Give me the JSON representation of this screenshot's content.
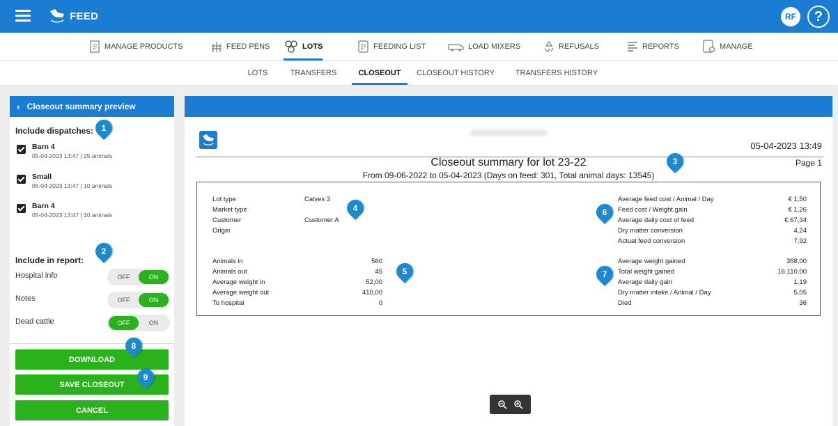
{
  "app": {
    "title": "FEED",
    "user_initials": "RF",
    "help_glyph": "?"
  },
  "main_nav": [
    {
      "label": "MANAGE PRODUCTS",
      "icon": "products-icon"
    },
    {
      "label": "FEED PENS",
      "icon": "pen-icon"
    },
    {
      "label": "LOTS",
      "icon": "lots-icon",
      "active": true
    },
    {
      "label": "FEEDING LIST",
      "icon": "list-icon"
    },
    {
      "label": "LOAD MIXERS",
      "icon": "mixer-icon"
    },
    {
      "label": "REFUSALS",
      "icon": "recycle-icon"
    },
    {
      "label": "REPORTS",
      "icon": "report-icon"
    },
    {
      "label": "MANAGE",
      "icon": "manage-icon"
    }
  ],
  "sub_nav": [
    {
      "label": "LOTS"
    },
    {
      "label": "TRANSFERS"
    },
    {
      "label": "CLOSEOUT",
      "active": true
    },
    {
      "label": "CLOSEOUT HISTORY"
    },
    {
      "label": "TRANSFERS HISTORY"
    }
  ],
  "left": {
    "header": "Closeout summary preview",
    "dispatches_title": "Include dispatches:",
    "dispatches": [
      {
        "name": "Barn 4",
        "detail": "05-04-2023 13:47 | 25 animals",
        "checked": true
      },
      {
        "name": "Small",
        "detail": "05-04-2023 13:47 | 10 animals",
        "checked": true
      },
      {
        "name": "Barn 4",
        "detail": "05-04-2023 13:47 | 10 animals",
        "checked": true
      }
    ],
    "report_title": "Include in report:",
    "options": [
      {
        "label": "Hospital info",
        "off": "OFF",
        "on": "ON",
        "state": "on"
      },
      {
        "label": "Notes",
        "off": "OFF",
        "on": "ON",
        "state": "on"
      },
      {
        "label": "Dead cattle",
        "off": "OFF",
        "on": "ON",
        "state": "off"
      }
    ],
    "buttons": {
      "download": "DOWNLOAD",
      "save": "SAVE CLOSEOUT",
      "cancel": "CANCEL"
    }
  },
  "doc": {
    "date": "05-04-2023 13:49",
    "title": "Closeout summary for lot 23-22",
    "page": "Page 1",
    "subtitle": "From 09-06-2022 to 05-04-2023  (Days on feed: 301, Total animal days: 13545)",
    "info_labels": [
      "Lot type",
      "Market type",
      "Customer",
      "Origin"
    ],
    "info_values": [
      "Calves 3",
      "",
      "Customer A",
      ""
    ],
    "animals_labels": [
      "Animals in",
      "Animals out",
      "Average weight in",
      "Average weight out",
      "To hospital"
    ],
    "animals_values": [
      "560",
      "45",
      "52,00",
      "410,00",
      "0"
    ],
    "cost_labels": [
      "Average feed cost / Animal / Day",
      "Feed cost / Weight.gain",
      "Average daily cost of feed",
      "Dry matter conversion",
      "Actual feed conversion"
    ],
    "cost_values": [
      "€ 1,50",
      "€ 1,26",
      "€ 67,34",
      "4,24",
      "7,92"
    ],
    "gain_labels": [
      "Average weight gained",
      "Total weight gained",
      "Average daily gain",
      "Dry matter intake / Animal / Day",
      "Died"
    ],
    "gain_values": [
      "358,00",
      "16.110,00",
      "1,19",
      "5,05",
      "36"
    ]
  },
  "markers": [
    "1",
    "2",
    "3",
    "4",
    "5",
    "6",
    "7",
    "8",
    "9"
  ],
  "zoom": {
    "out_icon": "zoom-out-icon",
    "in_icon": "zoom-in-icon"
  }
}
